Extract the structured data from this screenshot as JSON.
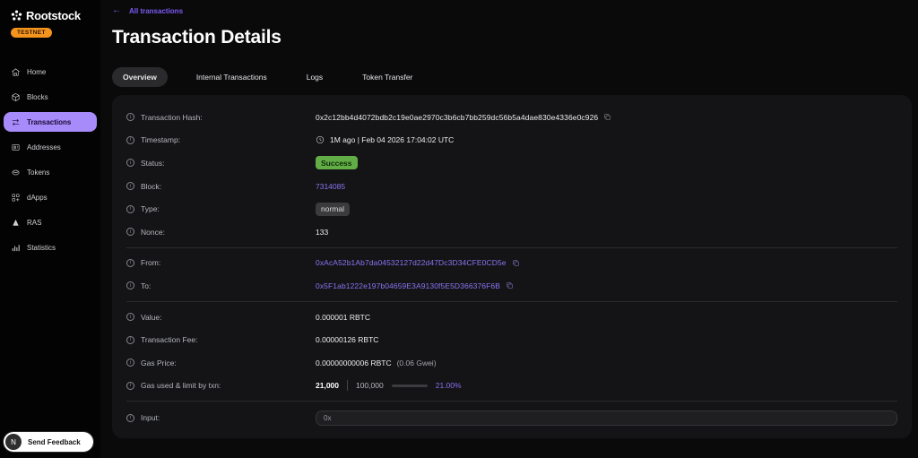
{
  "sidebar": {
    "brand": "Rootstock",
    "badge": "TESTNET",
    "items": [
      {
        "label": "Home",
        "active": false
      },
      {
        "label": "Blocks",
        "active": false
      },
      {
        "label": "Transactions",
        "active": true
      },
      {
        "label": "Addresses",
        "active": false
      },
      {
        "label": "Tokens",
        "active": false
      },
      {
        "label": "dApps",
        "active": false
      },
      {
        "label": "RAS",
        "active": false
      },
      {
        "label": "Statistics",
        "active": false
      }
    ],
    "feedback": {
      "label": "Send Feedback",
      "avatar": "N"
    }
  },
  "header": {
    "breadcrumb": "All transactions",
    "back_arrow": "←",
    "title": "Transaction Details",
    "tabs": [
      {
        "label": "Overview",
        "active": true
      },
      {
        "label": "Internal Transactions",
        "active": false
      },
      {
        "label": "Logs",
        "active": false
      },
      {
        "label": "Token Transfer",
        "active": false
      }
    ]
  },
  "details": {
    "hash": {
      "label": "Transaction Hash:",
      "value": "0x2c12bb4d4072bdb2c19e0ae2970c3b6cb7bb259dc56b5a4dae830e4336e0c926"
    },
    "timestamp": {
      "label": "Timestamp:",
      "value": "1M ago | Feb 04 2026 17:04:02 UTC"
    },
    "status": {
      "label": "Status:",
      "value": "Success"
    },
    "block": {
      "label": "Block:",
      "value": "7314085"
    },
    "type": {
      "label": "Type:",
      "value": "normal"
    },
    "nonce": {
      "label": "Nonce:",
      "value": "133"
    },
    "from": {
      "label": "From:",
      "value": "0xAcA52b1Ab7da04532127d22d47Dc3D34CFE0CD5e"
    },
    "to": {
      "label": "To:",
      "value": "0x5F1ab1222e197b04659E3A9130f5E5D366376F6B"
    },
    "value": {
      "label": "Value:",
      "value": "0.000001 RBTC"
    },
    "fee": {
      "label": "Transaction Fee:",
      "value": "0.00000126 RBTC"
    },
    "gas_price": {
      "label": "Gas Price:",
      "value": "0.00000000006 RBTC",
      "note": "(0.06 Gwei)"
    },
    "gas_used": {
      "label": "Gas used & limit by txn:",
      "used": "21,000",
      "limit": "100,000",
      "percent": "21.00%",
      "percent_value": 21
    },
    "input": {
      "label": "Input:",
      "value": "0x"
    }
  },
  "colors": {
    "accent_purple": "#a78bfa",
    "link_purple": "#8b74f3",
    "testnet_orange": "#f5941d",
    "success_green": "#63ad47",
    "panel_bg": "#141416",
    "sidebar_bg": "#030303"
  }
}
